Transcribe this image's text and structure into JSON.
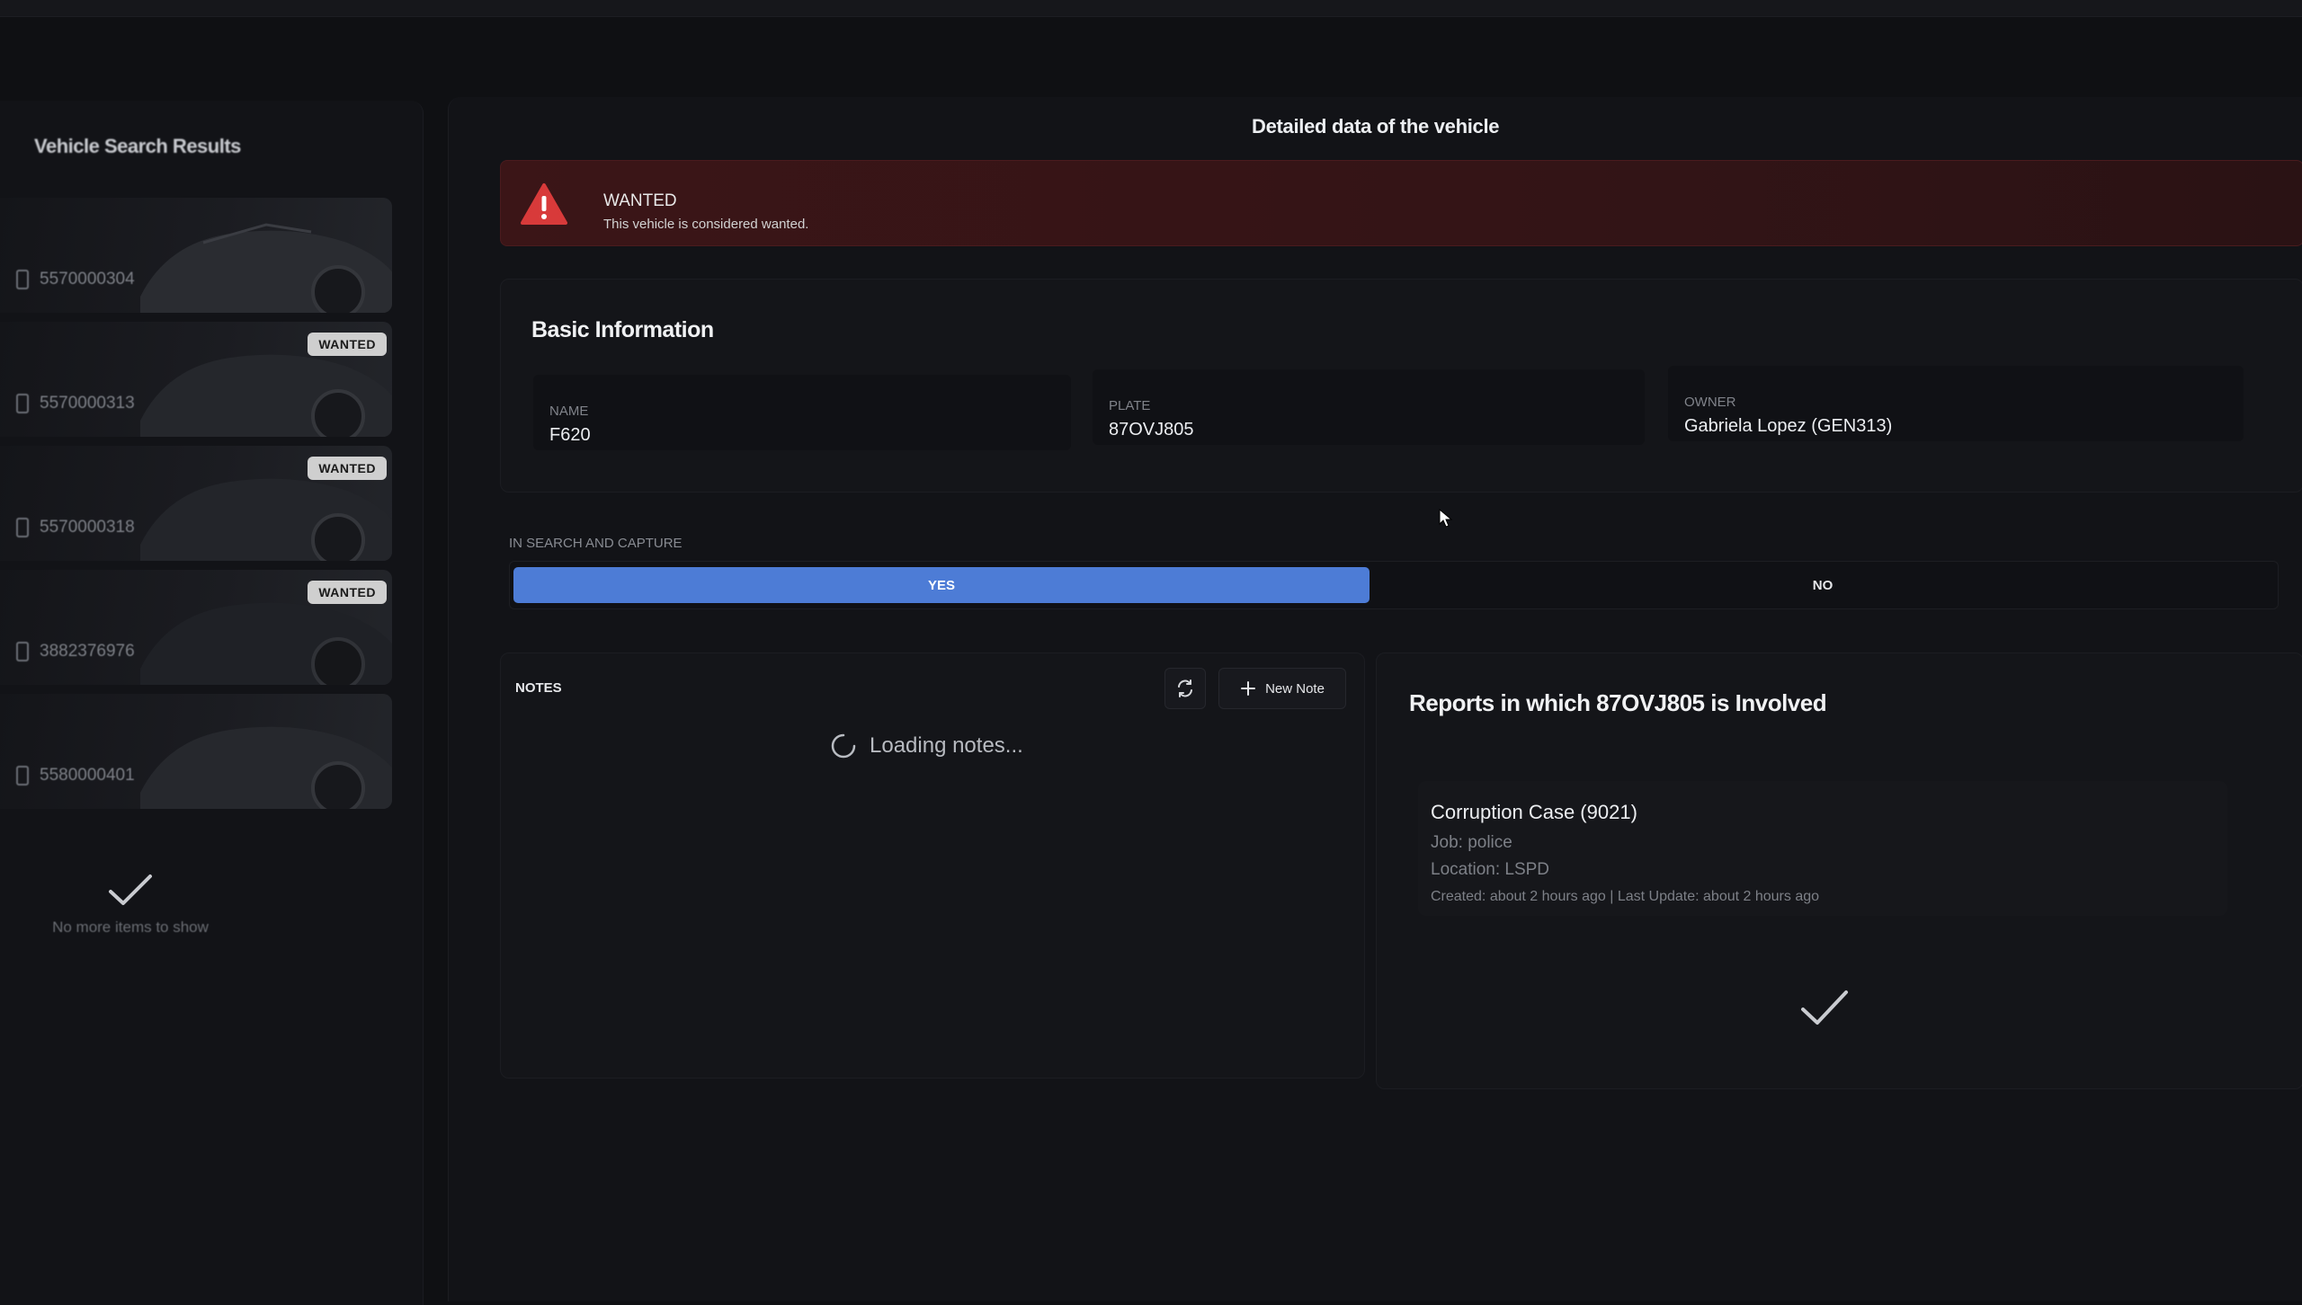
{
  "sidebar": {
    "title": "Vehicle Search Results",
    "results": [
      {
        "plate": "5570000304",
        "badge": ""
      },
      {
        "plate": "5570000313",
        "badge": "WANTED"
      },
      {
        "plate": "5570000318",
        "badge": "WANTED"
      },
      {
        "plate": "3882376976",
        "badge": "WANTED"
      },
      {
        "plate": "5580000401",
        "badge": ""
      }
    ],
    "end_text": "No more items to show"
  },
  "main": {
    "title": "Detailed data of the vehicle",
    "alert": {
      "title": "WANTED",
      "description": "This vehicle is considered wanted."
    },
    "basic_info": {
      "heading": "Basic Information",
      "name_label": "NAME",
      "name_value": "F620",
      "plate_label": "PLATE",
      "plate_value": "87OVJ805",
      "owner_label": "OWNER",
      "owner_value": "Gabriela Lopez (GEN313)"
    },
    "capture": {
      "label": "IN SEARCH AND CAPTURE",
      "yes": "YES",
      "no": "NO",
      "selected": "YES"
    },
    "notes": {
      "label": "NOTES",
      "new_note": "New Note",
      "loading": "Loading notes..."
    },
    "reports": {
      "title": "Reports in which 87OVJ805 is Involved",
      "items": [
        {
          "title": "Corruption Case (9021)",
          "job": "Job: police",
          "location": "Location: LSPD",
          "meta": "Created: about 2 hours ago | Last Update: about 2 hours ago"
        }
      ]
    }
  },
  "colors": {
    "accent": "#4d7cd6",
    "alert_bg": "#3b1517",
    "alert_icon": "#d83a3a",
    "badge_bg": "#cfcfcf"
  }
}
